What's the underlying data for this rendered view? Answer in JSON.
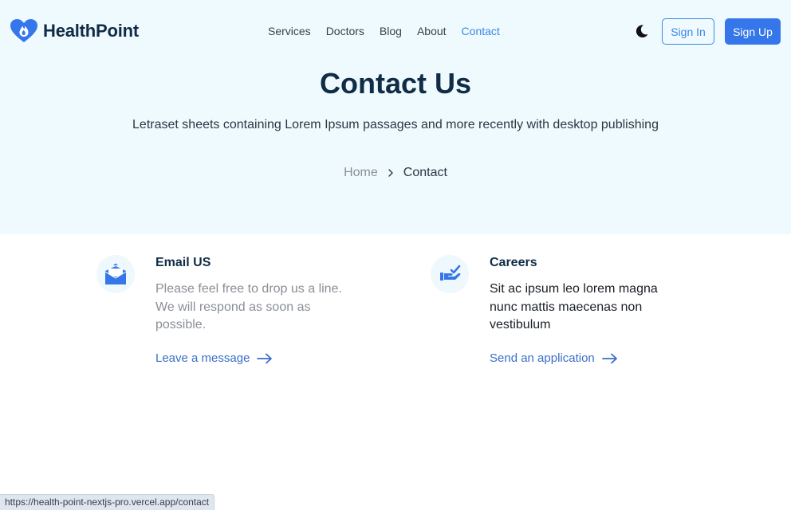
{
  "brand": {
    "name": "HealthPoint"
  },
  "nav": {
    "items": [
      {
        "label": "Services",
        "active": false
      },
      {
        "label": "Doctors",
        "active": false
      },
      {
        "label": "Blog",
        "active": false
      },
      {
        "label": "About",
        "active": false
      },
      {
        "label": "Contact",
        "active": true
      }
    ]
  },
  "header": {
    "theme_icon": "moon-icon",
    "signin_label": "Sign In",
    "signup_label": "Sign Up"
  },
  "hero": {
    "title": "Contact Us",
    "subtitle": "Letraset sheets containing Lorem Ipsum passages and more recently with desktop publishing",
    "breadcrumb": {
      "home": "Home",
      "separator_icon": "chevron-right-icon",
      "current": "Contact"
    }
  },
  "cards": [
    {
      "icon": "envelope-icon",
      "title": "Email US",
      "text": "Please feel free to drop us a line. We will respond as soon as possible.",
      "link": "Leave a message"
    },
    {
      "icon": "hand-check-icon",
      "title": "Careers",
      "text": "Sit ac ipsum leo lorem magna nunc mattis maecenas non vestibulum",
      "link": "Send an application"
    }
  ],
  "status_bar": {
    "url": "https://health-point-nextjs-pro.vercel.app/contact"
  },
  "colors": {
    "accent": "#3577eb",
    "link": "#3a6fc9",
    "hero_bg": "#effafe",
    "heading": "#102c46"
  }
}
